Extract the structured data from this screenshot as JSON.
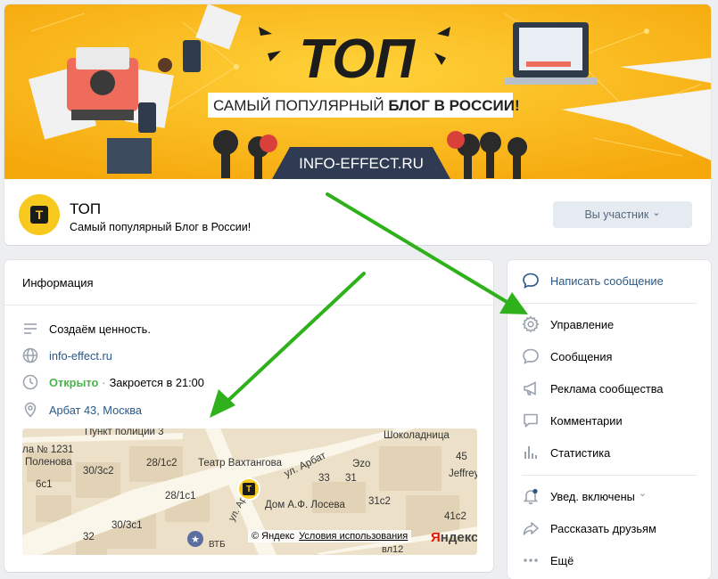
{
  "cover": {
    "headline": "ТОП",
    "tagline_plain": "САМЫЙ ПОПУЛЯРНЫЙ ",
    "tagline_bold": "БЛОГ В РОССИИ!",
    "site": "INFO-EFFECT.RU"
  },
  "group": {
    "name": "ТОП",
    "status": "Самый популярный Блог в России!",
    "avatar_letter": "T",
    "member_button": "Вы участник",
    "member_chevron": "⌄"
  },
  "info": {
    "title": "Информация",
    "description": "Создаём ценность.",
    "website": "info-effect.ru",
    "hours_status": "Открыто",
    "hours_sep": "·",
    "hours_detail": "Закроется в 21:00",
    "address": "Арбат 43, Москва"
  },
  "map": {
    "labels": {
      "police": "Пункт полиции 3",
      "school": "ла № 1231",
      "school2": "Поленова",
      "b6c1": "6с1",
      "b30_3c2": "30/3с2",
      "b28_1c2": "28/1с2",
      "theatre": "Театр Вахтангова",
      "b28_1c1": "28/1с1",
      "street_arbat": "ул. Арбат",
      "street_arbat2": "ул. Арбат",
      "b33": "33",
      "b31": "31",
      "ezo": "Эzo",
      "house": "Дом А.Ф. Лосева",
      "shop": "Шоколадница",
      "b45": "45",
      "jeffrey": "Jeffrey",
      "b31c2": "31с2",
      "b41c2": "41с2",
      "b30_3c1": "30/3с1",
      "b32": "32",
      "vtb": "ВТБ",
      "copyright": "© Яндекс",
      "terms": "Условия использования",
      "yandex": "Яндекс",
      "vl12": "вл12",
      "pin": "T"
    }
  },
  "actions": {
    "write": "Написать сообщение",
    "manage": "Управление",
    "messages": "Сообщения",
    "ads": "Реклама сообщества",
    "comments": "Комментарии",
    "stats": "Статистика",
    "notify": "Увед. включены",
    "notify_chevron": "⌄",
    "share": "Рассказать друзьям",
    "more": "Ещё"
  },
  "colors": {
    "accent": "#2a5885",
    "open": "#4bb34b",
    "cover_yellow": "#f7b617",
    "arrow_green": "#2fb11c"
  }
}
